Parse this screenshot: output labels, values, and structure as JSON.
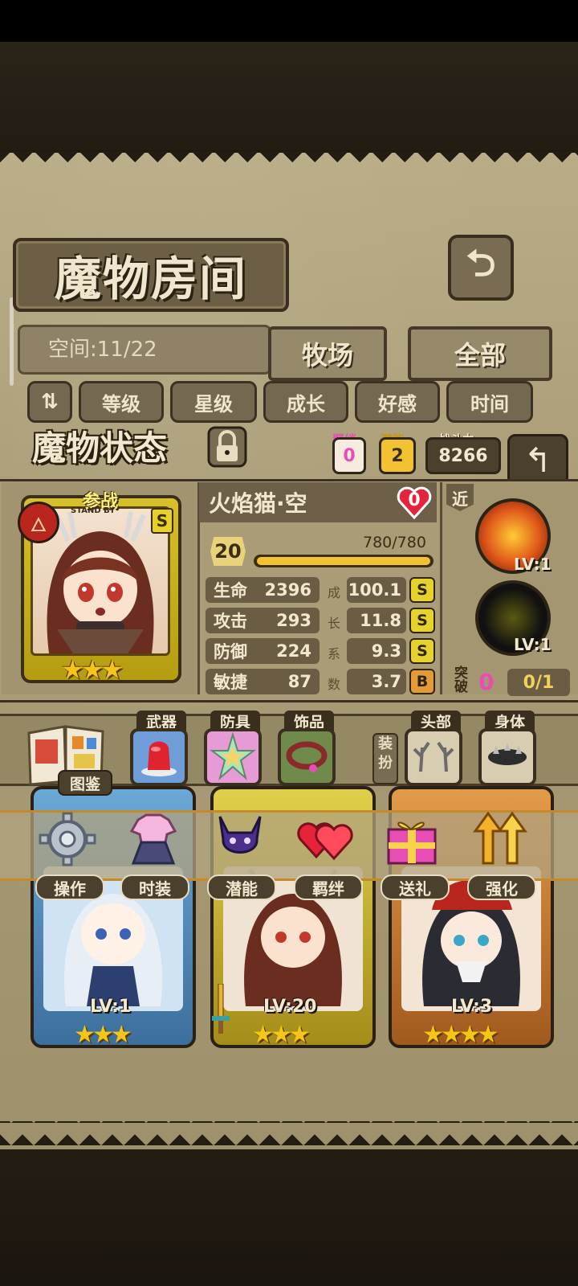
{
  "header": {
    "title": "魔物房间",
    "space_label": "空间:11/22",
    "tabs": [
      {
        "label": "牧场",
        "active": true
      },
      {
        "label": "全部",
        "active": false
      }
    ],
    "sort_buttons": [
      "等级",
      "星级",
      "成长",
      "好感",
      "时间"
    ]
  },
  "status": {
    "title": "魔物状态",
    "bond_label": "羁绊",
    "bond_value": "0",
    "potential_label": "潜能",
    "potential_value": "2",
    "power_label": "战斗力",
    "power_value": "8266",
    "standby_label": "参战",
    "standby_sub": "STAND BY",
    "rank": "S",
    "monster_name": "火焰猫·空",
    "affection": "0",
    "level": "20",
    "exp_text": "780/780",
    "exp_fraction": 1.0,
    "star_count": 3,
    "stats": [
      {
        "label": "生命",
        "value": "2396",
        "growth": "100.1",
        "grade": "S"
      },
      {
        "label": "攻击",
        "value": "293",
        "growth": "11.8",
        "grade": "S"
      },
      {
        "label": "防御",
        "value": "224",
        "growth": "9.3",
        "grade": "S"
      },
      {
        "label": "敏捷",
        "value": "87",
        "growth": "3.7",
        "grade": "B"
      }
    ],
    "growth_chars": [
      "成",
      "长",
      "系",
      "数"
    ],
    "range_tag": "近",
    "skills": [
      {
        "icon": "fire-skill-icon",
        "level": "LV:1"
      },
      {
        "icon": "dark-skill-icon",
        "level": "LV:1"
      }
    ],
    "breakthrough_label": "突破",
    "breakthrough_count": "0",
    "breakthrough_progress": "0/1"
  },
  "equipment": {
    "book_label": "图鉴",
    "slots": [
      {
        "label": "武器",
        "icon": "jelly-icon"
      },
      {
        "label": "防具",
        "icon": "crystal-star-icon"
      },
      {
        "label": "饰品",
        "icon": "collar-icon"
      }
    ],
    "dress_label": "装扮",
    "dress_slots": [
      {
        "label": "头部",
        "icon": "antler-icon"
      },
      {
        "label": "身体",
        "icon": "spiked-collar-icon"
      }
    ]
  },
  "actions": [
    {
      "label": "操作",
      "icon": "gear-icon"
    },
    {
      "label": "时装",
      "icon": "outfit-icon"
    },
    {
      "label": "潜能",
      "icon": "demon-icon"
    },
    {
      "label": "羁绊",
      "icon": "hearts-icon"
    },
    {
      "label": "送礼",
      "icon": "gift-icon"
    },
    {
      "label": "强化",
      "icon": "upgrade-arrows-icon"
    }
  ],
  "monster_cards": [
    {
      "level": "LV:1",
      "stars": 3,
      "frame": "blue"
    },
    {
      "level": "LV:20",
      "stars": 3,
      "frame": "gold"
    },
    {
      "level": "LV:3",
      "stars": 4,
      "frame": "orange"
    }
  ],
  "colors": {
    "rank_gold": "#e5d22c",
    "bond_pink": "#e94db4",
    "potential_gold": "#f2c230"
  }
}
